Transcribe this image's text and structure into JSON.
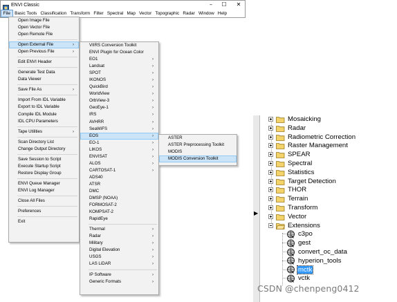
{
  "window": {
    "title": "ENVI Classic",
    "minimize": "–",
    "maximize": "☐",
    "close": "✕"
  },
  "menubar": [
    "File",
    "Basic Tools",
    "Classification",
    "Transform",
    "Filter",
    "Spectral",
    "Map",
    "Vector",
    "Topographic",
    "Radar",
    "Window",
    "Help"
  ],
  "file_menu": [
    {
      "label": "Open Image File"
    },
    {
      "label": "Open Vector File"
    },
    {
      "label": "Open Remote File"
    },
    {
      "sep": true
    },
    {
      "label": "Open External File",
      "arrow": true,
      "hl": true
    },
    {
      "label": "Open Previous File",
      "arrow": true
    },
    {
      "sep": true
    },
    {
      "label": "Edit ENVI Header"
    },
    {
      "sep": true
    },
    {
      "label": "Generate Test Data"
    },
    {
      "label": "Data Viewer"
    },
    {
      "sep": true
    },
    {
      "label": "Save File As",
      "arrow": true
    },
    {
      "sep": true
    },
    {
      "label": "Import From IDL Variable"
    },
    {
      "label": "Export to IDL Variable"
    },
    {
      "label": "Compile IDL Module"
    },
    {
      "label": "IDL CPU Parameters"
    },
    {
      "sep": true
    },
    {
      "label": "Tape Utilities",
      "arrow": true
    },
    {
      "sep": true
    },
    {
      "label": "Scan Directory List"
    },
    {
      "label": "Change Output Directory"
    },
    {
      "sep": true
    },
    {
      "label": "Save Session to Script"
    },
    {
      "label": "Execute Startup Script"
    },
    {
      "label": "Restore Display Group"
    },
    {
      "sep": true
    },
    {
      "label": "ENVI Queue Manager"
    },
    {
      "label": "ENVI Log Manager"
    },
    {
      "sep": true
    },
    {
      "label": "Close All Files"
    },
    {
      "sep": true
    },
    {
      "label": "Preferences"
    },
    {
      "sep": true
    },
    {
      "label": "Exit"
    }
  ],
  "external_menu": [
    {
      "label": "VIIRS Conversion Toolkit"
    },
    {
      "label": "ENVI Plugin for Ocean Color"
    },
    {
      "label": "EO1",
      "arrow": true
    },
    {
      "label": "Landsat",
      "arrow": true
    },
    {
      "label": "SPOT",
      "arrow": true
    },
    {
      "label": "IKONOS",
      "arrow": true
    },
    {
      "label": "QuickBird",
      "arrow": true
    },
    {
      "label": "WorldView",
      "arrow": true
    },
    {
      "label": "OrbView-3",
      "arrow": true
    },
    {
      "label": "GeoEye-1",
      "arrow": true
    },
    {
      "label": "IRS",
      "arrow": true
    },
    {
      "label": "AVHRR",
      "arrow": true
    },
    {
      "label": "SeaWiFS",
      "arrow": true
    },
    {
      "label": "EOS",
      "arrow": true,
      "hl": true
    },
    {
      "label": "EO-1",
      "arrow": true
    },
    {
      "label": "LIKOS",
      "arrow": true
    },
    {
      "label": "ENVISAT",
      "arrow": true
    },
    {
      "label": "ALOS",
      "arrow": true
    },
    {
      "label": "CARTOSAT-1",
      "arrow": true
    },
    {
      "label": "ADS40"
    },
    {
      "label": "ATSR"
    },
    {
      "label": "DMC"
    },
    {
      "label": "DMSP (NOAA)"
    },
    {
      "label": "FORMOSAT-2"
    },
    {
      "label": "KOMPSAT-2"
    },
    {
      "label": "RapidEye"
    },
    {
      "sep": true
    },
    {
      "label": "Thermal",
      "arrow": true
    },
    {
      "label": "Radar",
      "arrow": true
    },
    {
      "label": "Military",
      "arrow": true
    },
    {
      "label": "Digital Elevation",
      "arrow": true
    },
    {
      "label": "USGS",
      "arrow": true
    },
    {
      "label": "LAS LiDAR",
      "arrow": true
    },
    {
      "sep": true
    },
    {
      "label": "IP Software",
      "arrow": true
    },
    {
      "label": "Generic Formats",
      "arrow": true
    }
  ],
  "eos_menu": [
    {
      "label": "ASTER"
    },
    {
      "label": "ASTER Preprocessing Toolkit"
    },
    {
      "label": "MODIS"
    },
    {
      "label": "MODIS Conversion Toolkit",
      "hl": true
    }
  ],
  "tree": {
    "folders": [
      "Mosaicking",
      "Radar",
      "Radiometric Correction",
      "Raster Management",
      "SPEAR",
      "Spectral",
      "Statistics",
      "Target Detection",
      "THOR",
      "Terrain",
      "Transform",
      "Vector",
      "Extensions"
    ],
    "extensions": [
      "c3po",
      "gest",
      "convert_oc_data",
      "hyperion_tools",
      "mctk",
      "vctk"
    ],
    "selected": "mctk",
    "folder_color": "#f4d36b",
    "select_color": "#3399ff"
  },
  "watermark": "CSDN @chenpeng0412"
}
